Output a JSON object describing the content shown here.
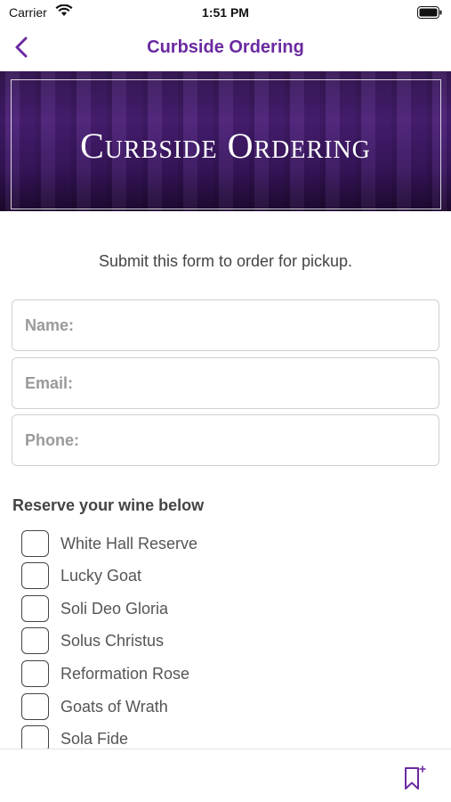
{
  "status": {
    "carrier": "Carrier",
    "time": "1:51 PM"
  },
  "nav": {
    "title": "Curbside Ordering"
  },
  "hero": {
    "title": "Curbside Ordering"
  },
  "intro": "Submit this form to order for pickup.",
  "form": {
    "name_placeholder": "Name:",
    "email_placeholder": "Email:",
    "phone_placeholder": "Phone:"
  },
  "wines": {
    "title": "Reserve your wine below",
    "items": [
      {
        "label": "White Hall Reserve"
      },
      {
        "label": "Lucky Goat"
      },
      {
        "label": "Soli Deo Gloria"
      },
      {
        "label": "Solus Christus"
      },
      {
        "label": "Reformation Rose"
      },
      {
        "label": "Goats of Wrath"
      },
      {
        "label": "Sola Fide"
      }
    ]
  },
  "colors": {
    "accent": "#6a2aa0"
  },
  "icons": {
    "back": "chevron-left-icon",
    "bookmark": "bookmark-add-icon"
  }
}
